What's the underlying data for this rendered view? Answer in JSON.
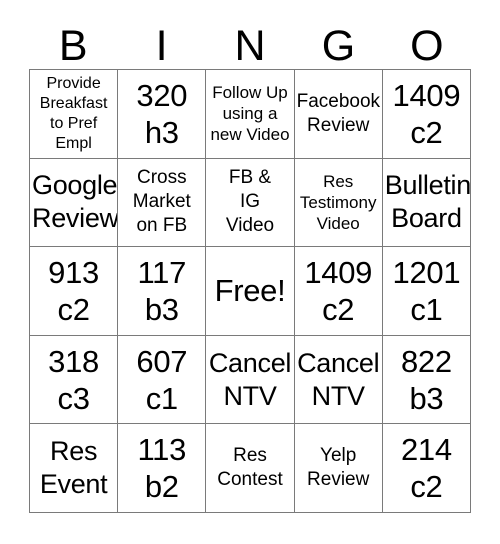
{
  "card": {
    "header_letters": [
      "B",
      "I",
      "N",
      "G",
      "O"
    ],
    "free_space_label": "Free!",
    "grid": {
      "columns": 5,
      "rows": 5,
      "cells": [
        {
          "text": "Provide\nBreakfast\nto Pref\nEmpl",
          "size": "xs",
          "column": "B",
          "row": 1,
          "free": false
        },
        {
          "text": "320\nh3",
          "size": "xl",
          "column": "I",
          "row": 1,
          "free": false
        },
        {
          "text": "Follow Up\nusing a\nnew Video",
          "size": "sm",
          "column": "N",
          "row": 1,
          "free": false
        },
        {
          "text": "Facebook\nReview",
          "size": "md",
          "column": "G",
          "row": 1,
          "free": false
        },
        {
          "text": "1409\nc2",
          "size": "xl",
          "column": "O",
          "row": 1,
          "free": false
        },
        {
          "text": "Google\nReview",
          "size": "lg",
          "column": "B",
          "row": 2,
          "free": false
        },
        {
          "text": "Cross\nMarket\non FB",
          "size": "md",
          "column": "I",
          "row": 2,
          "free": false
        },
        {
          "text": "FB &\nIG\nVideo",
          "size": "md",
          "column": "N",
          "row": 2,
          "free": false
        },
        {
          "text": "Res\nTestimony\nVideo",
          "size": "sm",
          "column": "G",
          "row": 2,
          "free": false
        },
        {
          "text": "Bulletin\nBoard",
          "size": "lg",
          "column": "O",
          "row": 2,
          "free": false
        },
        {
          "text": "913\nc2",
          "size": "xl",
          "column": "B",
          "row": 3,
          "free": false
        },
        {
          "text": "117\nb3",
          "size": "xl",
          "column": "I",
          "row": 3,
          "free": false
        },
        {
          "text": "Free!",
          "size": "xl",
          "column": "N",
          "row": 3,
          "free": true
        },
        {
          "text": "1409\nc2",
          "size": "xl",
          "column": "G",
          "row": 3,
          "free": false
        },
        {
          "text": "1201\nc1",
          "size": "xl",
          "column": "O",
          "row": 3,
          "free": false
        },
        {
          "text": "318\nc3",
          "size": "xl",
          "column": "B",
          "row": 4,
          "free": false
        },
        {
          "text": "607\nc1",
          "size": "xl",
          "column": "I",
          "row": 4,
          "free": false
        },
        {
          "text": "Cancel\nNTV",
          "size": "lg",
          "column": "N",
          "row": 4,
          "free": false
        },
        {
          "text": "Cancel\nNTV",
          "size": "lg",
          "column": "G",
          "row": 4,
          "free": false
        },
        {
          "text": "822\nb3",
          "size": "xl",
          "column": "O",
          "row": 4,
          "free": false
        },
        {
          "text": "Res\nEvent",
          "size": "lg",
          "column": "B",
          "row": 5,
          "free": false
        },
        {
          "text": "113\nb2",
          "size": "xl",
          "column": "I",
          "row": 5,
          "free": false
        },
        {
          "text": "Res\nContest",
          "size": "md",
          "column": "N",
          "row": 5,
          "free": false
        },
        {
          "text": "Yelp\nReview",
          "size": "md",
          "column": "G",
          "row": 5,
          "free": false
        },
        {
          "text": "214\nc2",
          "size": "xl",
          "column": "O",
          "row": 5,
          "free": false
        }
      ]
    },
    "colors": {
      "background": "#ffffff",
      "text": "#000000",
      "grid_line": "#7a7a7a"
    }
  }
}
